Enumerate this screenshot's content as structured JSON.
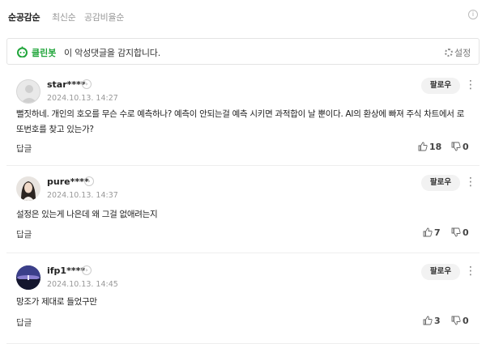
{
  "sort": {
    "tabs": [
      {
        "label": "순공감순",
        "active": true
      },
      {
        "label": "최신순",
        "active": false
      },
      {
        "label": "공감비율순",
        "active": false
      }
    ],
    "info_icon": "info-icon"
  },
  "cleanbot": {
    "name": "클린봇",
    "text": "이 악성댓글을 감지합니다.",
    "settings_label": "설정",
    "accent_color": "#20a53a"
  },
  "comments": [
    {
      "nickname": "star****",
      "date": "2024.10.13. 14:27",
      "follow_label": "팔로우",
      "body": "뻘짓하네. 개인의 호오를 무슨 수로 예측하나? 예측이 안되는걸 예측 시키면 과적합이 날 뿐이다. AI의 환상에 빠져 주식 차트에서 로또번호를 찾고 있는가?",
      "reply_label": "답글",
      "likes": "18",
      "dislikes": "0",
      "avatar": "default-avatar"
    },
    {
      "nickname": "pure****",
      "date": "2024.10.13. 14:37",
      "follow_label": "팔로우",
      "body": "설정은 있는게 나은데 왜 그걸 없애려는지",
      "reply_label": "답글",
      "likes": "7",
      "dislikes": "0",
      "avatar": "photo-avatar"
    },
    {
      "nickname": "ifp1****",
      "date": "2024.10.13. 14:45",
      "follow_label": "팔로우",
      "body": "망조가 제대로 들었구만",
      "reply_label": "답글",
      "likes": "3",
      "dislikes": "0",
      "avatar": "photo-avatar"
    }
  ]
}
